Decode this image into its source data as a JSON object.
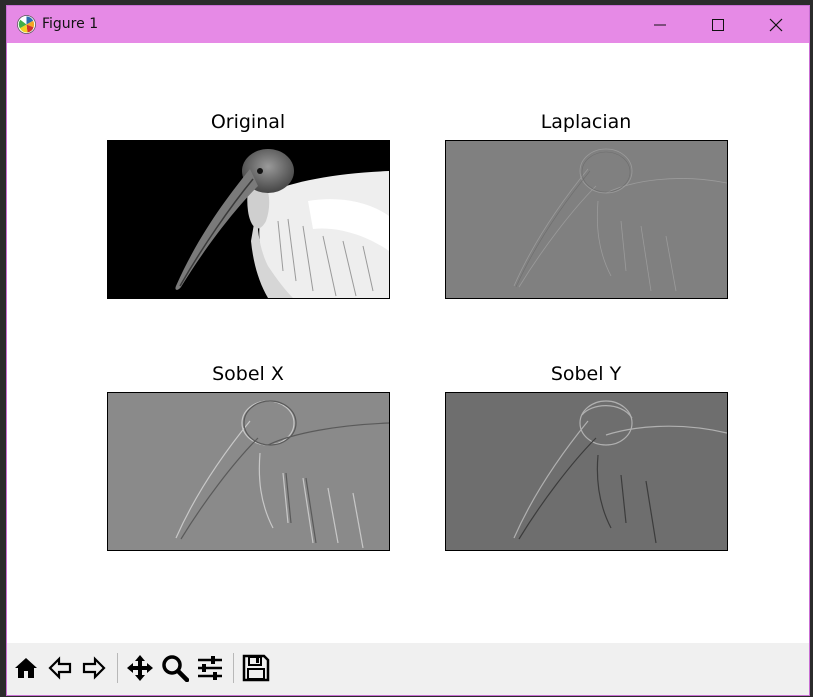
{
  "window": {
    "title": "Figure 1",
    "titlebar_color": "#e68ae6",
    "controls": [
      "minimize-icon",
      "maximize-icon",
      "close-icon"
    ]
  },
  "figure": {
    "subplots": [
      {
        "title": "Original",
        "filter": "original",
        "background": "#000000"
      },
      {
        "title": "Laplacian",
        "filter": "laplacian",
        "background": "#808080"
      },
      {
        "title": "Sobel X",
        "filter": "sobel-x",
        "background": "#808080"
      },
      {
        "title": "Sobel Y",
        "filter": "sobel-y",
        "background": "#6e6e6e"
      }
    ]
  },
  "toolbar": {
    "tools": [
      "home-icon",
      "back-arrow-icon",
      "forward-arrow-icon",
      "pan-icon",
      "zoom-icon",
      "configure-subplots-icon",
      "save-icon"
    ]
  }
}
